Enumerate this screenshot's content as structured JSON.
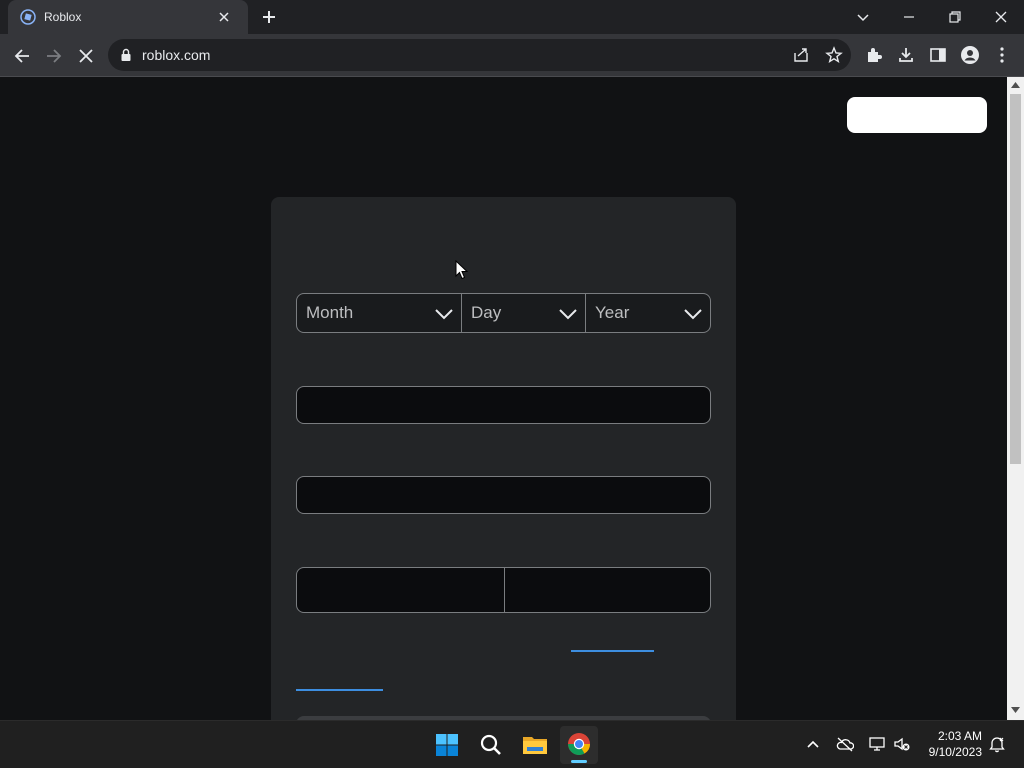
{
  "browser": {
    "tab": {
      "title": "Roblox",
      "favicon": "roblox-favicon"
    },
    "address_bar": {
      "url": "roblox.com",
      "secure_icon": "lock-icon"
    },
    "icons": [
      "back-arrow-icon",
      "forward-arrow-icon",
      "stop-loading-icon",
      "share-icon",
      "star-icon",
      "extensions-icon",
      "download-icon",
      "side-panel-icon",
      "profile-icon",
      "menu-icon"
    ]
  },
  "page": {
    "header": {
      "login_button": ""
    },
    "signup_form": {
      "birthday": {
        "month": {
          "selected": "Month"
        },
        "day": {
          "selected": "Day"
        },
        "year": {
          "selected": "Year"
        }
      },
      "username": {
        "value": ""
      },
      "password": {
        "value": ""
      }
    }
  },
  "taskbar": {
    "apps": [
      "windows-start-icon",
      "search-icon",
      "file-explorer-icon",
      "chrome-icon"
    ],
    "clock": {
      "time": "2:03 AM",
      "date": "9/10/2023"
    }
  },
  "colors": {
    "page_bg": "#111214",
    "card_bg": "#232527",
    "link": "#3d8ee0",
    "taskbar_accent": "#60cdff"
  }
}
